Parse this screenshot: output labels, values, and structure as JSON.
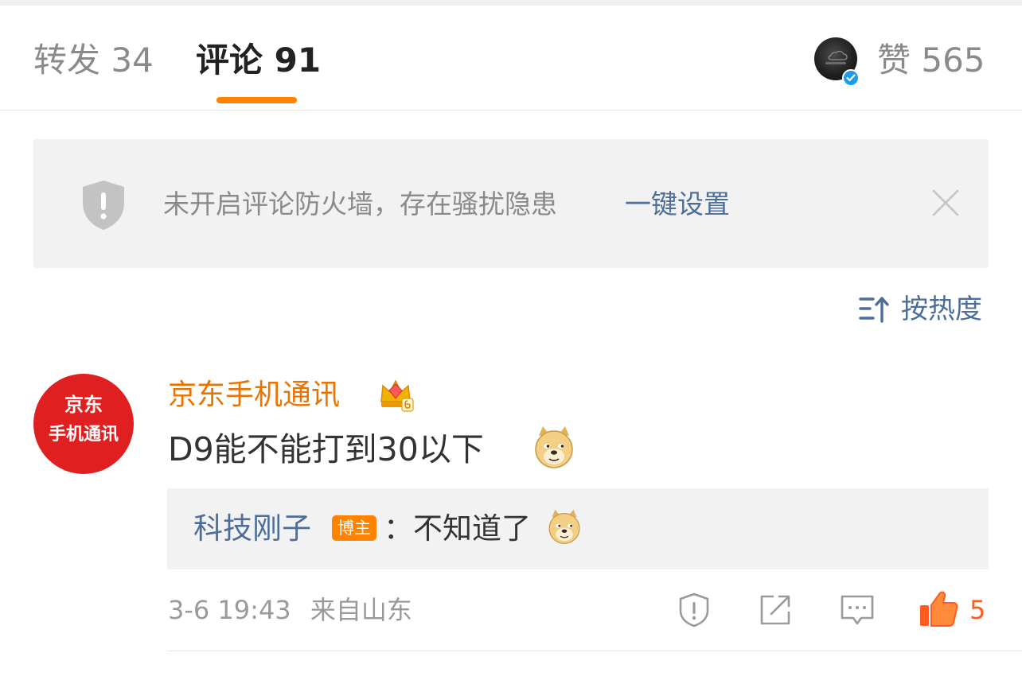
{
  "tabs": {
    "repost_label": "转发 34",
    "comment_label": "评论 91",
    "likes_label": "赞 565"
  },
  "accent_color": "#ff8200",
  "link_color": "#4d6e99",
  "notice": {
    "text": "未开启评论防火墙，存在骚扰隐患",
    "link": "一键设置",
    "icon": "shield-exclamation-icon",
    "close_icon": "close-icon"
  },
  "sort": {
    "label": "按热度",
    "icon": "sort-icon"
  },
  "comment": {
    "avatar_line1": "京东",
    "avatar_line2": "手机通讯",
    "username": "京东手机通讯",
    "username_color": "#eb7300",
    "text": "D9能不能打到30以下",
    "emoji": "doge-emoji",
    "reply": {
      "user": "科技刚子",
      "badge": "博主",
      "text": "：不知道了",
      "emoji": "doge-emoji"
    },
    "time": "3-6 19:43",
    "location": "来自山东",
    "like_count": "5",
    "actions": [
      "report-icon",
      "share-icon",
      "comment-icon",
      "thumbs-up-icon"
    ]
  }
}
